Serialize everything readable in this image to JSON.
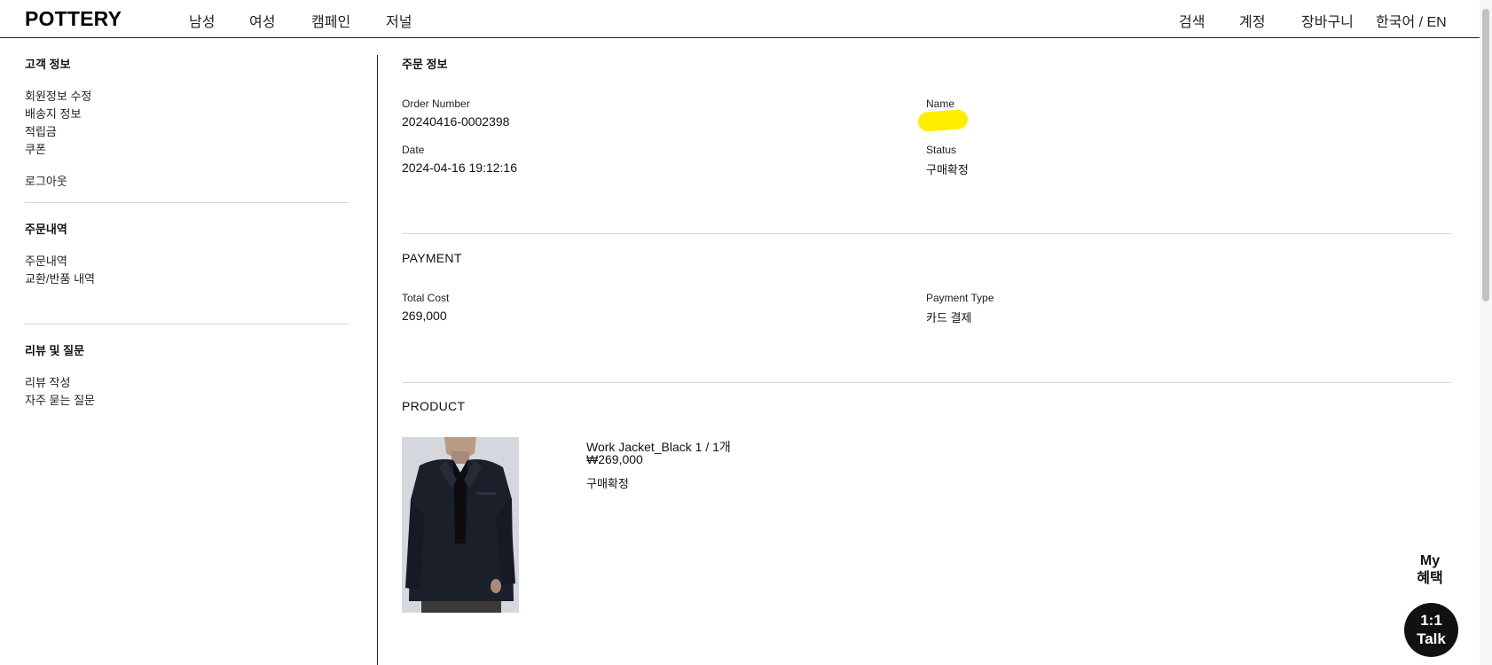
{
  "header": {
    "logo": "POTTERY",
    "nav": [
      "남성",
      "여성",
      "캠페인",
      "저널"
    ],
    "utils": [
      "검색",
      "계정",
      "장바구니",
      "한국어 / EN"
    ]
  },
  "sidebar": {
    "customer": {
      "title": "고객 정보",
      "links": [
        "회원정보 수정",
        "배송지 정보",
        "적립금",
        "쿠폰"
      ],
      "logout": "로그아웃"
    },
    "orders": {
      "title": "주문내역",
      "links": [
        "주문내역",
        "교환/반품 내역"
      ]
    },
    "reviews": {
      "title": "리뷰 및 질문",
      "links": [
        "리뷰 작성",
        "자주 묻는 질문"
      ]
    }
  },
  "order_info": {
    "title": "주문 정보",
    "order_number_label": "Order Number",
    "order_number": "20240416-0002398",
    "name_label": "Name",
    "date_label": "Date",
    "date": "2024-04-16 19:12:16",
    "status_label": "Status",
    "status": "구매확정"
  },
  "payment": {
    "title": "PAYMENT",
    "total_cost_label": "Total Cost",
    "total_cost": "269,000",
    "payment_type_label": "Payment Type",
    "payment_type": "카드 결제"
  },
  "product": {
    "title": "PRODUCT",
    "name": "Work Jacket_Black 1 / 1개",
    "price": "₩269,000",
    "status": "구매확정"
  },
  "floating": {
    "my_benefit_line1": "My",
    "my_benefit_line2": "혜택",
    "talk_line1": "1:1",
    "talk_line2": "Talk"
  },
  "colors": {
    "redaction": "#ffee00",
    "talk_button": "#111111"
  }
}
